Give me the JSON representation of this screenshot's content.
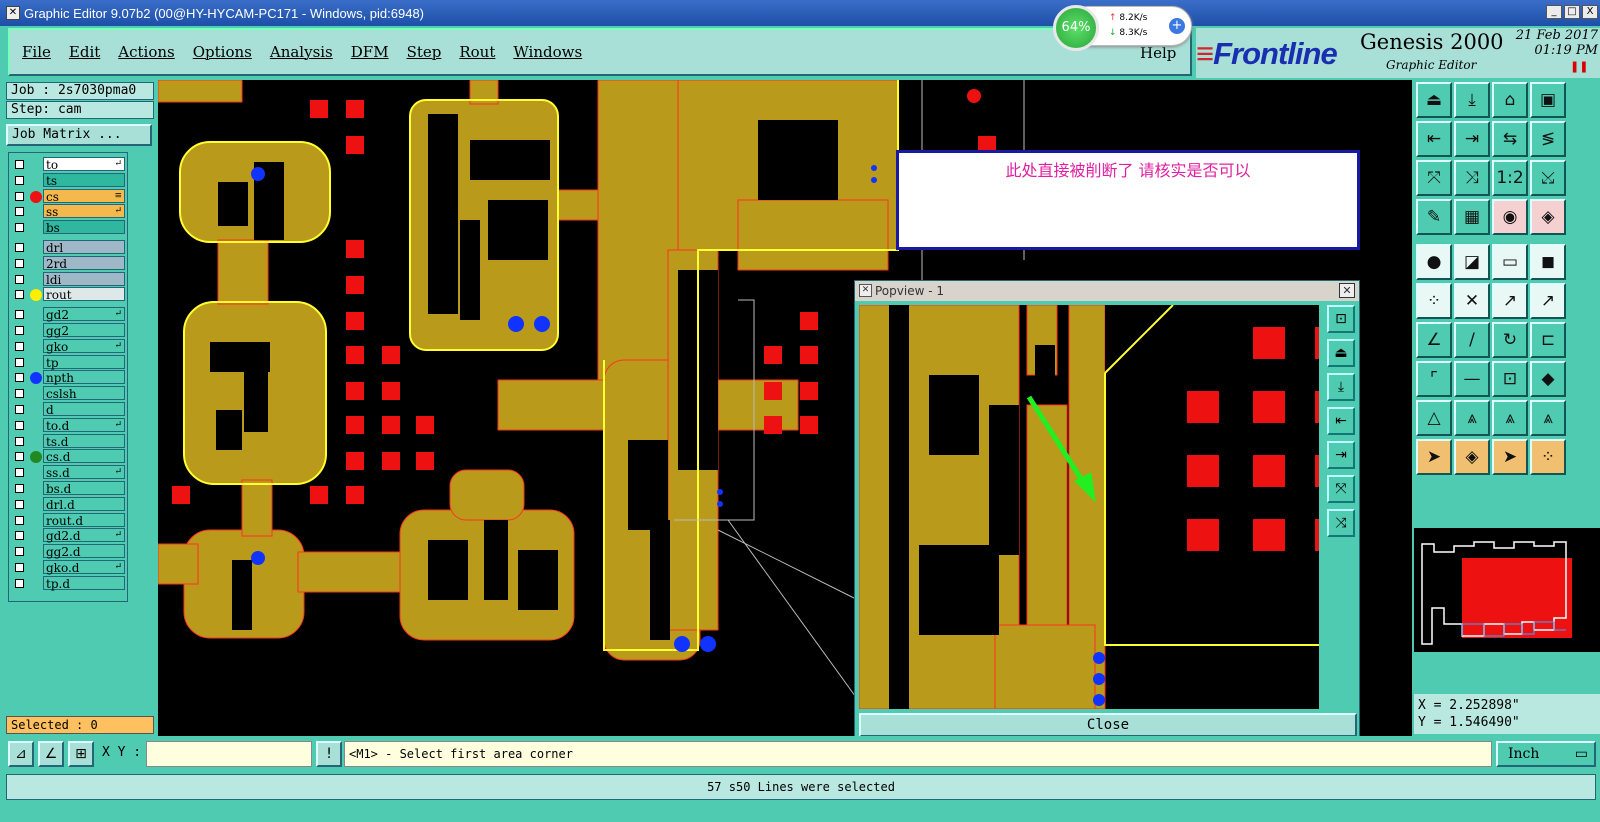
{
  "window": {
    "title": "Graphic Editor 9.07b2 (00@HY-HYCAM-PC171 - Windows, pid:6948)",
    "controls": [
      "_",
      "□",
      "X"
    ]
  },
  "menu": [
    "File",
    "Edit",
    "Actions",
    "Options",
    "Analysis",
    "DFM",
    "Step",
    "Rout",
    "Windows"
  ],
  "help": "Help",
  "brand": {
    "logo": "Frontline",
    "product": "Genesis 2000",
    "subtitle": "Graphic Editor",
    "date": "21 Feb 2017",
    "time": "01:19 PM"
  },
  "net_widget": {
    "percent": "64%",
    "up": "8.2K/s",
    "down": "8.3K/s"
  },
  "job": {
    "job": "Job : 2s7030pma0",
    "step": "Step: cam",
    "matrix_button": "Job Matrix ..."
  },
  "layers": [
    {
      "name": "to",
      "bg": "#ffffff",
      "dot": null,
      "x": "↵"
    },
    {
      "name": "ts",
      "bg": "#2fb79f",
      "dot": null,
      "x": ""
    },
    {
      "name": "cs",
      "bg": "#f5b84c",
      "dot": "#ee1111",
      "x": "≡"
    },
    {
      "name": "ss",
      "bg": "#f5b84c",
      "dot": null,
      "x": "↵"
    },
    {
      "name": "bs",
      "bg": "#2fb79f",
      "dot": null,
      "x": ""
    },
    {
      "name": "drl",
      "bg": "#9fb8c8",
      "dot": null,
      "x": ""
    },
    {
      "name": "2rd",
      "bg": "#9fb8c8",
      "dot": null,
      "x": ""
    },
    {
      "name": "ldi",
      "bg": "#9fb8c8",
      "dot": null,
      "x": ""
    },
    {
      "name": "rout",
      "bg": "#dfe8e8",
      "dot": "#ffee00",
      "x": ""
    },
    {
      "name": "gd2",
      "bg": "#4ecbb1",
      "dot": null,
      "x": "↵"
    },
    {
      "name": "gg2",
      "bg": "#4ecbb1",
      "dot": null,
      "x": ""
    },
    {
      "name": "gko",
      "bg": "#4ecbb1",
      "dot": null,
      "x": "↵"
    },
    {
      "name": "tp",
      "bg": "#4ecbb1",
      "dot": null,
      "x": ""
    },
    {
      "name": "npth",
      "bg": "#4ecbb1",
      "dot": "#1133ff",
      "x": ""
    },
    {
      "name": "cslsh",
      "bg": "#4ecbb1",
      "dot": null,
      "x": ""
    },
    {
      "name": "d",
      "bg": "#4ecbb1",
      "dot": null,
      "x": ""
    },
    {
      "name": "to.d",
      "bg": "#4ecbb1",
      "dot": null,
      "x": "↵"
    },
    {
      "name": "ts.d",
      "bg": "#4ecbb1",
      "dot": null,
      "x": ""
    },
    {
      "name": "cs.d",
      "bg": "#4ecbb1",
      "dot": "#228822",
      "x": ""
    },
    {
      "name": "ss.d",
      "bg": "#4ecbb1",
      "dot": null,
      "x": "↵"
    },
    {
      "name": "bs.d",
      "bg": "#4ecbb1",
      "dot": null,
      "x": ""
    },
    {
      "name": "drl.d",
      "bg": "#4ecbb1",
      "dot": null,
      "x": ""
    },
    {
      "name": "rout.d",
      "bg": "#4ecbb1",
      "dot": null,
      "x": ""
    },
    {
      "name": "gd2.d",
      "bg": "#4ecbb1",
      "dot": null,
      "x": "↵"
    },
    {
      "name": "gg2.d",
      "bg": "#4ecbb1",
      "dot": null,
      "x": ""
    },
    {
      "name": "gko.d",
      "bg": "#4ecbb1",
      "dot": null,
      "x": "↵"
    },
    {
      "name": "tp.d",
      "bg": "#4ecbb1",
      "dot": null,
      "x": ""
    }
  ],
  "selected": "Selected : 0",
  "note": "此处直接被削断了    请核实是否可以",
  "popview": {
    "title": "Popview - 1",
    "close_button": "Close"
  },
  "right_tools": [
    "⏏",
    "⤓",
    "⌂",
    "▣",
    "⇤",
    "⇥",
    "⇆",
    "≶",
    "⤧",
    "⤨",
    "1:2",
    "⤩",
    "✎",
    "▦",
    "◉",
    "◈",
    "●",
    "◪",
    "▭",
    "◼",
    "⁘",
    "✕",
    "↗",
    "↗",
    "∠",
    "/",
    "↻",
    "⊏",
    "⌜",
    "—",
    "⊡",
    "◆",
    "△",
    "⩓",
    "⩓",
    "⩓",
    "➤",
    "◈",
    "➤",
    "⁘"
  ],
  "coords": {
    "x": "X = 2.252898\"",
    "y": "Y = 1.546490\""
  },
  "xy_label": "X Y :",
  "command_msg": "<M1> - Select first area corner",
  "units": "Inch",
  "status": "57 s50 Lines were selected",
  "colors": {
    "copper": "#b99a1b",
    "pad": "#ee1111",
    "outline": "#ffff33",
    "panel": "#4ecbb1",
    "arrow": "#22ee22"
  }
}
